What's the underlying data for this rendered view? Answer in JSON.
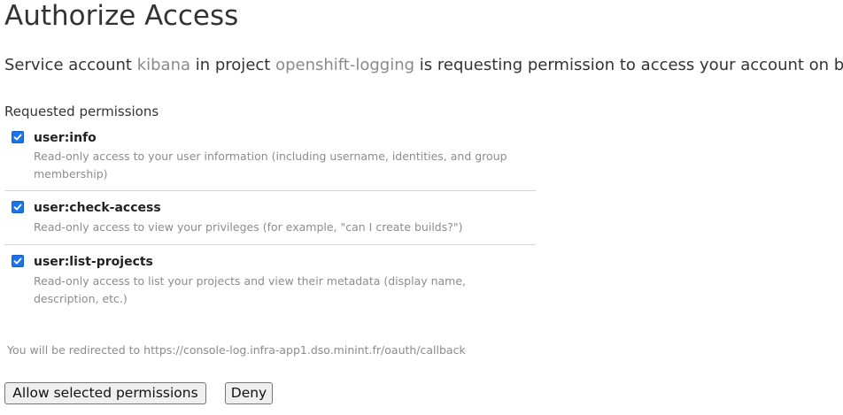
{
  "page": {
    "title": "Authorize Access"
  },
  "intro": {
    "prefix": "Service account ",
    "account_name": "kibana",
    "middle": " in project ",
    "project_name": "openshift-logging",
    "suffix": " is requesting permission to access your account on behalf of",
    "muted_color": "#8a8a8a"
  },
  "permissions": {
    "heading": "Requested permissions",
    "items": [
      {
        "name": "user:info",
        "description": "Read-only access to your user information (including username, identities, and group membership)",
        "checked": true
      },
      {
        "name": "user:check-access",
        "description": "Read-only access to view your privileges (for example, \"can I create builds?\")",
        "checked": true
      },
      {
        "name": "user:list-projects",
        "description": "Read-only access to list your projects and view their metadata (display name, description, etc.)",
        "checked": true
      }
    ]
  },
  "redirect": {
    "text": "You will be redirected to https://console-log.infra-app1.dso.minint.fr/oauth/callback"
  },
  "actions": {
    "allow_label": "Allow selected permissions",
    "deny_label": "Deny"
  },
  "colors": {
    "checkbox_accent": "#1a73e8",
    "muted_text": "#8c8c8c"
  }
}
